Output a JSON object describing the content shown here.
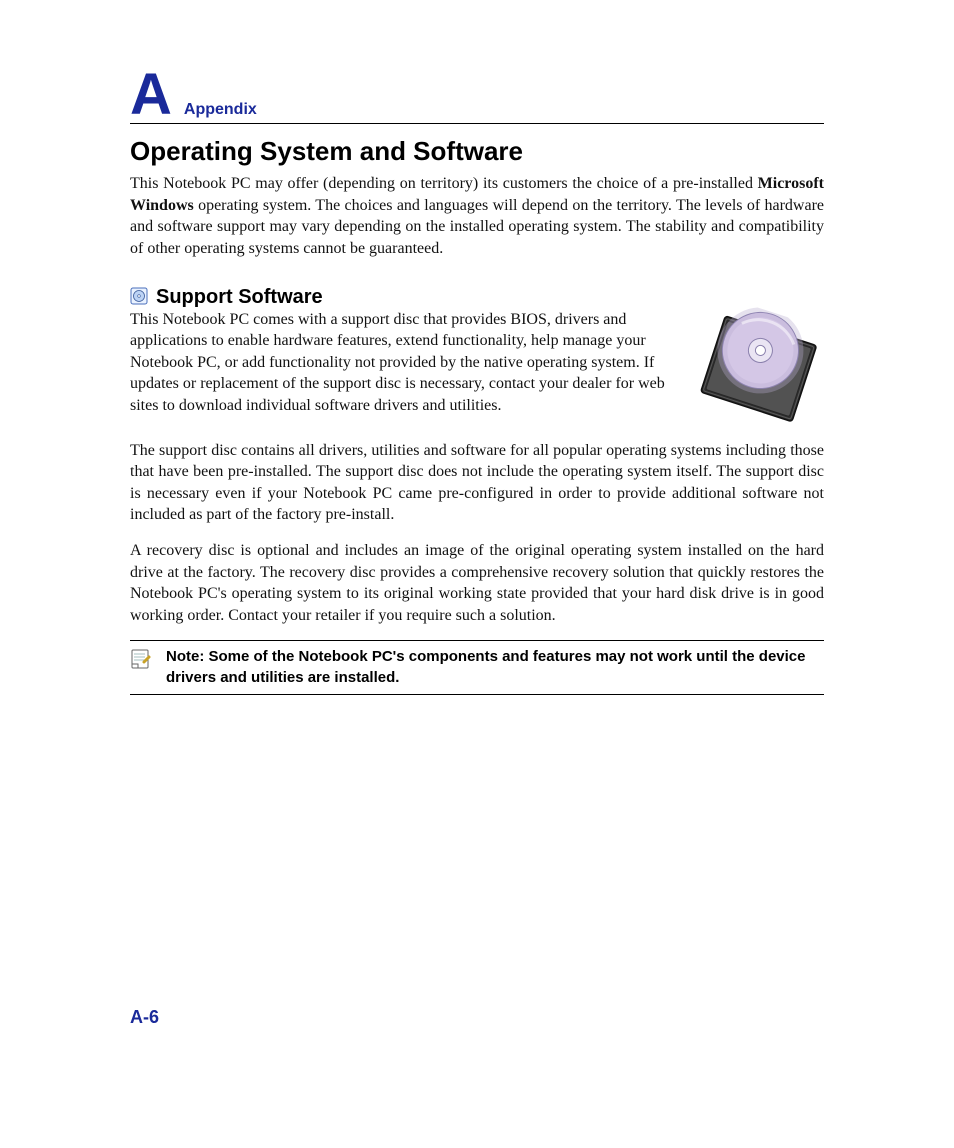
{
  "header": {
    "letter": "A",
    "label": "Appendix"
  },
  "title": "Operating System and Software",
  "intro": {
    "pre_bold": "This Notebook PC may offer (depending on territory) its customers the choice of a pre-installed ",
    "bold": "Microsoft Windows",
    "post_bold": " operating system. The choices and languages will depend on the territory. The levels of hardware and software support may vary depending on the installed operating system. The stability and compatibility of other operating systems cannot be guaranteed."
  },
  "support": {
    "heading": "Support Software",
    "p1": "This Notebook PC comes with a support disc that provides BIOS, drivers and applications to enable hardware features, extend functionality, help manage your Notebook PC, or add functionality not provided by the native operating system. If updates or replacement of the support disc is necessary, contact your dealer for web sites to download individual software drivers and utilities.",
    "p2": "The support disc contains all drivers, utilities and software for all popular operating systems including those that have been pre-installed. The support disc does not include the operating system itself. The support disc is necessary even if your Notebook PC came pre-configured in order to provide additional software not included as part of the factory pre-install.",
    "p3": "A recovery disc is optional and includes an image of the original operating system installed on the hard drive at the factory. The recovery disc provides a comprehensive recovery solution that quickly restores the Notebook PC's operating system to its original working state provided that your hard disk drive is in good working order. Contact your retailer if you require such a solution."
  },
  "note": "Note: Some of the Notebook PC's components and features may not work until the device drivers and utilities are installed.",
  "page_number": "A-6"
}
